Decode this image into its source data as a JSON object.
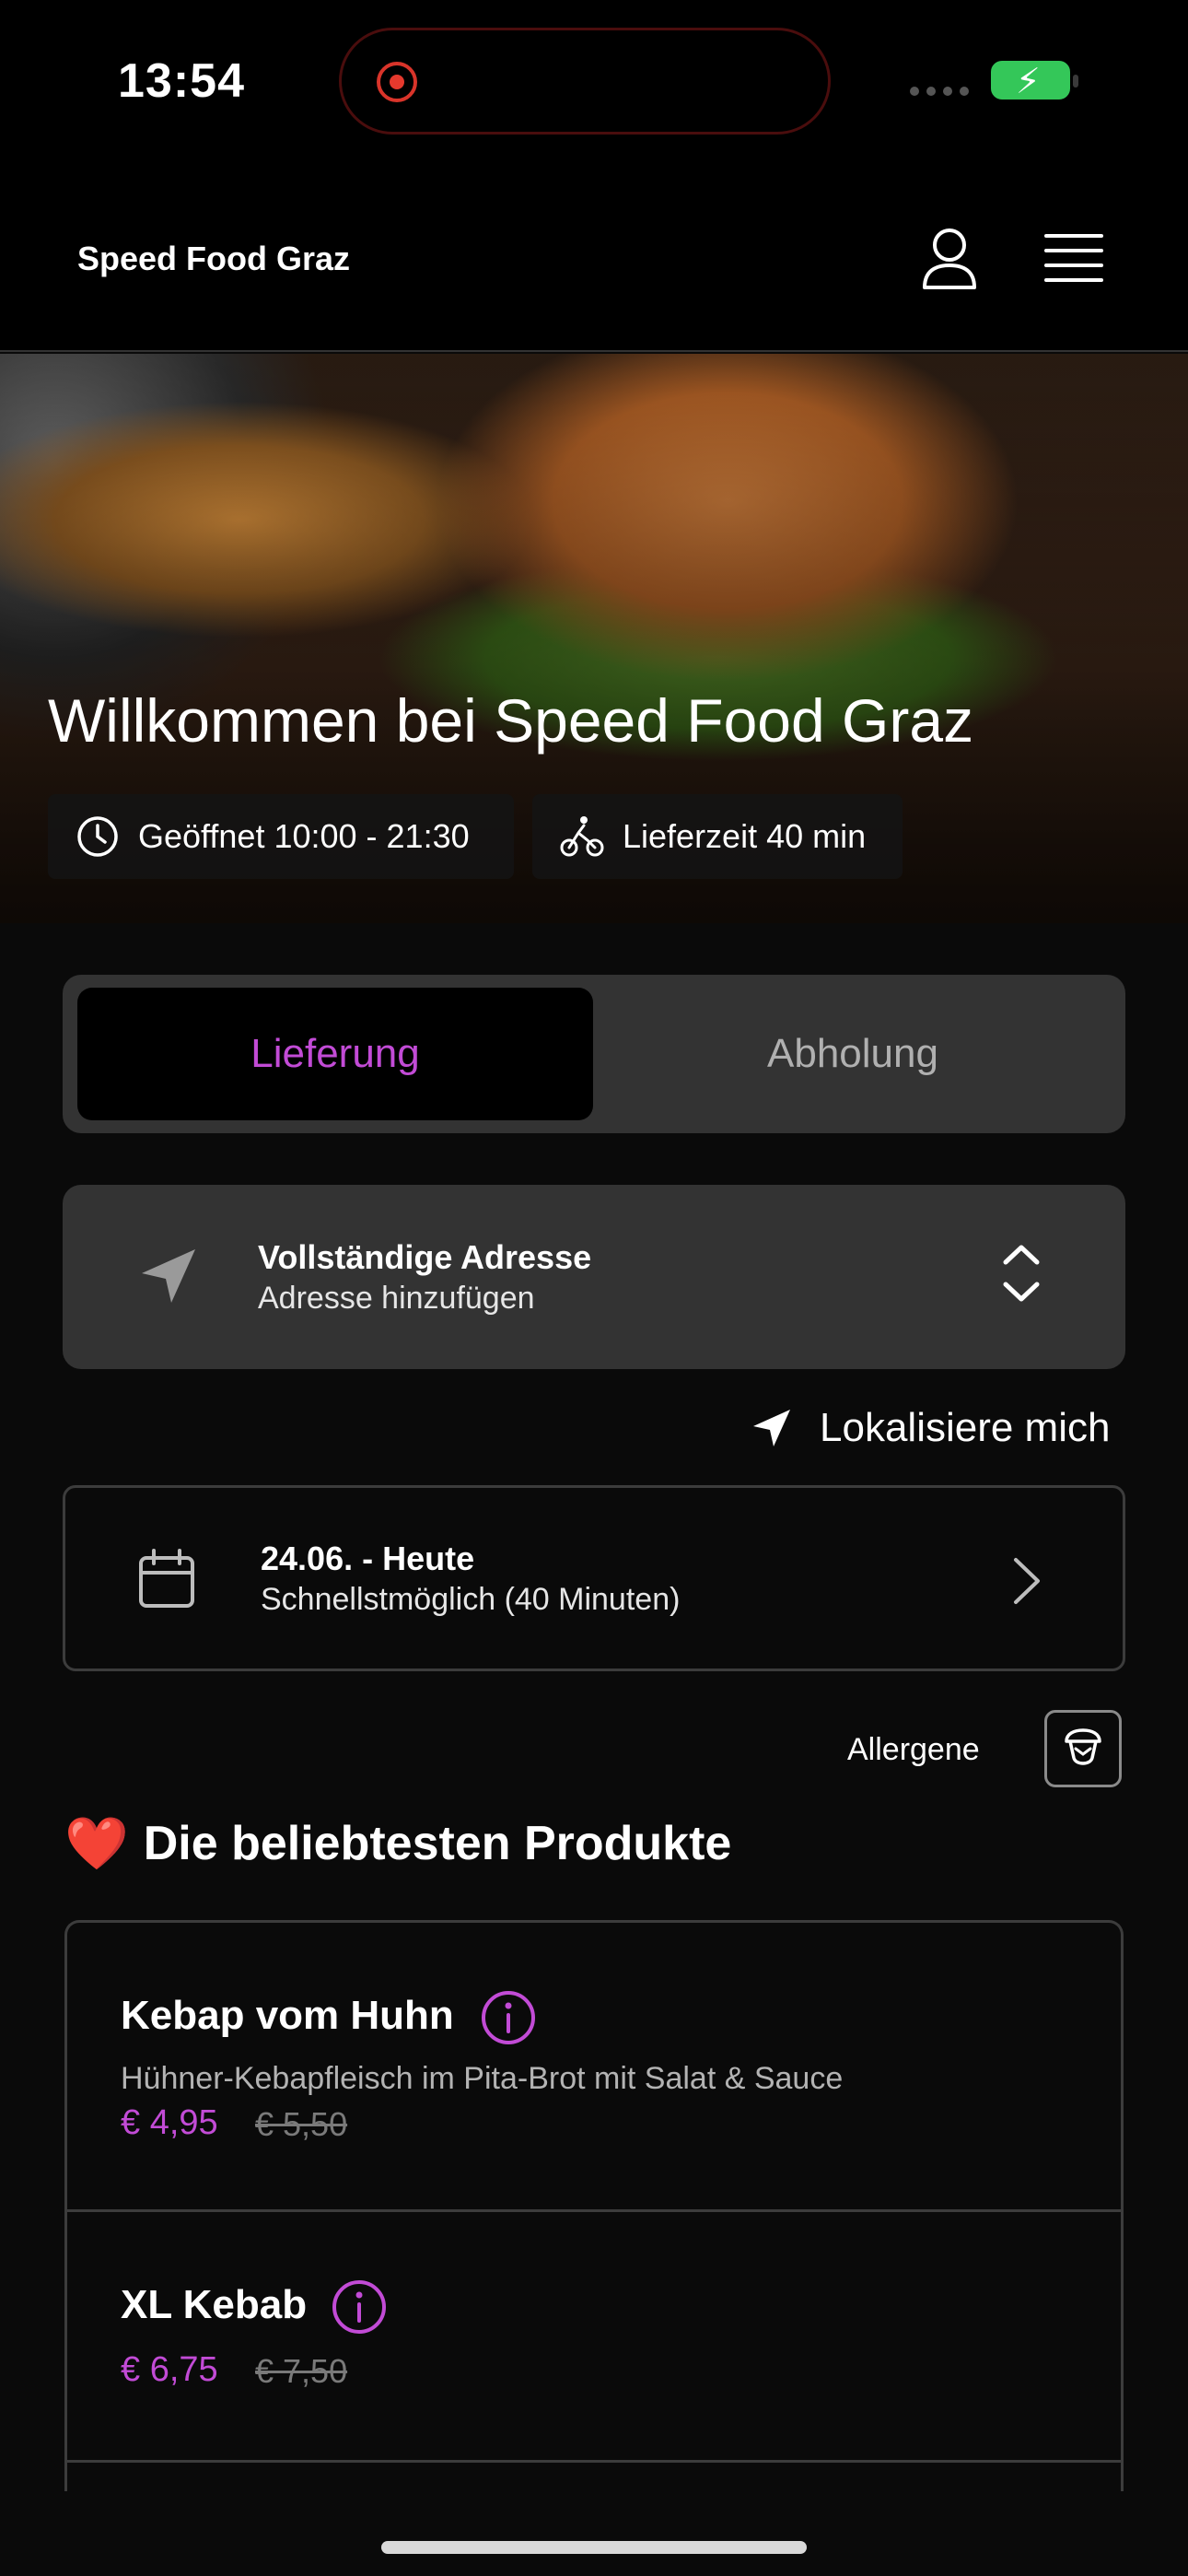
{
  "status_bar": {
    "time": "13:54"
  },
  "header": {
    "brand": "Speed Food Graz",
    "user_icon": "user-icon",
    "menu_icon": "hamburger-menu-icon"
  },
  "hero": {
    "title": "Willkommen bei Speed Food Graz",
    "opening_hours": "Geöffnet 10:00 - 21:30",
    "delivery_time": "Lieferzeit 40 min"
  },
  "order_mode": {
    "options": [
      "Lieferung",
      "Abholung"
    ],
    "selected": "Lieferung"
  },
  "address": {
    "title": "Vollständige Adresse",
    "subtitle": "Adresse hinzufügen"
  },
  "locate_label": "Lokalisiere mich",
  "schedule": {
    "date": "24.06. - Heute",
    "time": "Schnellstmöglich (40 Minuten)"
  },
  "allergens_label": "Allergene",
  "section": {
    "icon": "❤️",
    "title": "Die beliebtesten Produkte"
  },
  "products": [
    {
      "name": "Kebap vom Huhn",
      "description": "Hühner-Kebapfleisch im Pita-Brot mit Salat & Sauce",
      "price": "€ 4,95",
      "old_price": "€ 5,50"
    },
    {
      "name": "XL Kebab",
      "description": "",
      "price": "€ 6,75",
      "old_price": "€ 7,50"
    }
  ],
  "colors": {
    "accent": "#c24bd6",
    "background": "#0a0a0a",
    "card": "#333333",
    "battery": "#34c759"
  }
}
